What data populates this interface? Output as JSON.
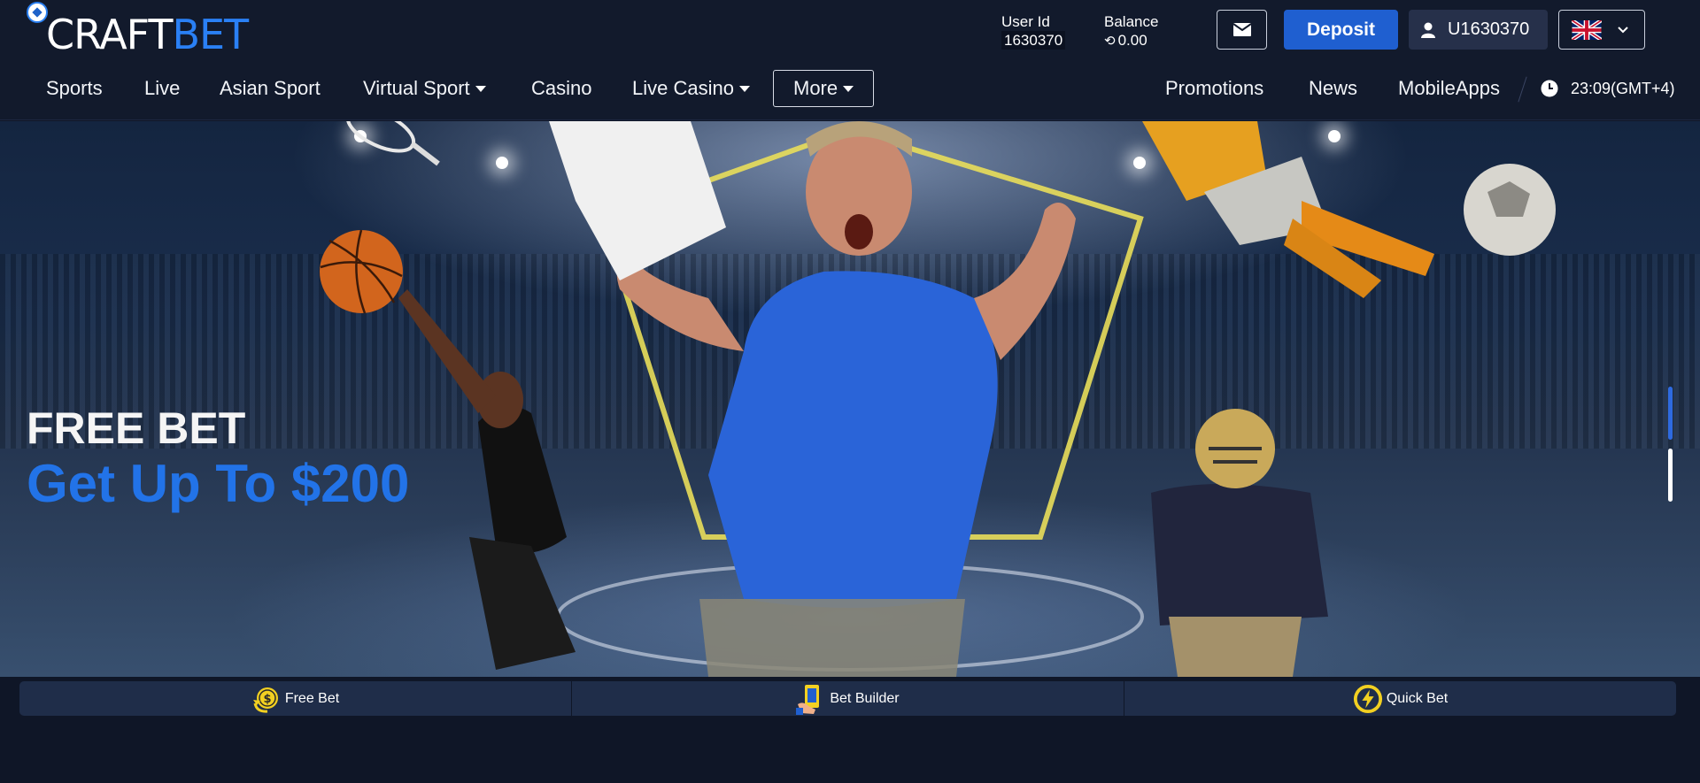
{
  "logo": {
    "part1": "CRAFT",
    "part2": "BET"
  },
  "account": {
    "user_id_label": "User Id",
    "user_id": "1630370",
    "balance_label": "Balance",
    "balance_currency_icon": "coin-icon",
    "balance": "0.00",
    "message_icon": "envelope-icon",
    "deposit_label": "Deposit",
    "username": "U1630370",
    "language_flag": "uk-flag-icon"
  },
  "nav": {
    "left": [
      {
        "label": "Sports",
        "dropdown": false
      },
      {
        "label": "Live",
        "dropdown": false
      },
      {
        "label": "Asian Sport",
        "dropdown": false
      },
      {
        "label": "Virtual Sport",
        "dropdown": true
      },
      {
        "label": "Casino",
        "dropdown": false
      },
      {
        "label": "Live Casino",
        "dropdown": true
      },
      {
        "label": "More",
        "dropdown": true
      }
    ],
    "right": [
      {
        "label": "Promotions"
      },
      {
        "label": "News"
      },
      {
        "label": "MobileApps"
      }
    ],
    "clock": "23:09(GMT+4)"
  },
  "banner": {
    "headline": "FREE BET",
    "subheadline": "Get Up To $200",
    "slides_count": 2,
    "active_slide": 1
  },
  "quickbar": [
    {
      "label": "Free Bet",
      "icon": "free-bet-coin-icon"
    },
    {
      "label": "Bet Builder",
      "icon": "bet-builder-phone-icon"
    },
    {
      "label": "Quick Bet",
      "icon": "quick-bet-lightning-icon"
    }
  ],
  "colors": {
    "brand_blue": "#2a80f5",
    "deposit": "#1f5fd0",
    "background": "#0f1627",
    "accent_yellow": "#f2d021"
  }
}
